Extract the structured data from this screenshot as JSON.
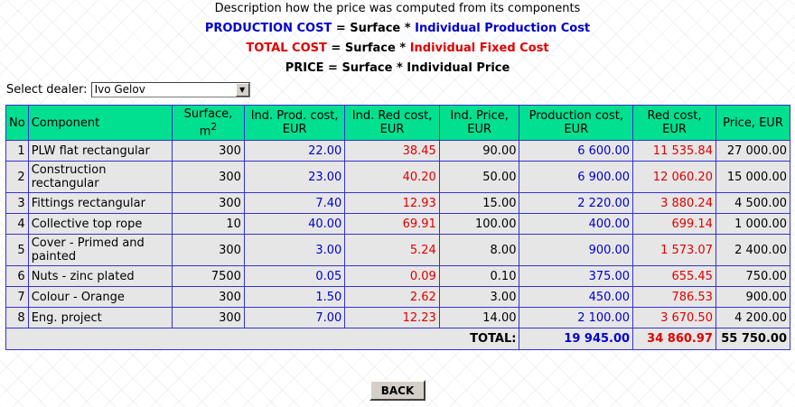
{
  "description": {
    "heading": "Description how the price was computed from its components",
    "line1": {
      "term": "PRODUCTION COST",
      "eq": " = ",
      "surface": "Surface",
      "op": " * ",
      "factor": "Individual Production Cost"
    },
    "line2": {
      "term": "TOTAL COST",
      "eq": " = ",
      "surface": "Surface",
      "op": " * ",
      "factor": "Individual Fixed Cost"
    },
    "line3": {
      "term": "PRICE",
      "eq": " = ",
      "surface": "Surface",
      "op": " * ",
      "factor": "Individual Price"
    }
  },
  "dealer": {
    "label": "Select dealer:",
    "selected": "Ivo Gelov"
  },
  "table": {
    "headers": {
      "no": "No",
      "component": "Component",
      "surface": "Surface,",
      "surface_unit": "m",
      "surface_sup": "2",
      "ind_prod_l1": "Ind. Prod. cost,",
      "ind_prod_l2": "EUR",
      "ind_red_l1": "Ind. Red cost,",
      "ind_red_l2": "EUR",
      "ind_price_l1": "Ind. Price,",
      "ind_price_l2": "EUR",
      "prod_cost_l1": "Production cost,",
      "prod_cost_l2": "EUR",
      "red_cost_l1": "Red cost,",
      "red_cost_l2": "EUR",
      "price": "Price, EUR"
    },
    "rows": [
      {
        "no": "1",
        "component": "PLW flat rectangular",
        "surface": "300",
        "ind_prod": "22.00",
        "ind_red": "38.45",
        "ind_price": "90.00",
        "prod_cost": "6 600.00",
        "red_cost": "11 535.84",
        "price": "27 000.00"
      },
      {
        "no": "2",
        "component": "Construction rectangular",
        "surface": "300",
        "ind_prod": "23.00",
        "ind_red": "40.20",
        "ind_price": "50.00",
        "prod_cost": "6 900.00",
        "red_cost": "12 060.20",
        "price": "15 000.00"
      },
      {
        "no": "3",
        "component": "Fittings rectangular",
        "surface": "300",
        "ind_prod": "7.40",
        "ind_red": "12.93",
        "ind_price": "15.00",
        "prod_cost": "2 220.00",
        "red_cost": "3 880.24",
        "price": "4 500.00"
      },
      {
        "no": "4",
        "component": "Collective top rope",
        "surface": "10",
        "ind_prod": "40.00",
        "ind_red": "69.91",
        "ind_price": "100.00",
        "prod_cost": "400.00",
        "red_cost": "699.14",
        "price": "1 000.00"
      },
      {
        "no": "5",
        "component": "Cover - Primed and painted",
        "surface": "300",
        "ind_prod": "3.00",
        "ind_red": "5.24",
        "ind_price": "8.00",
        "prod_cost": "900.00",
        "red_cost": "1 573.07",
        "price": "2 400.00"
      },
      {
        "no": "6",
        "component": "Nuts - zinc plated",
        "surface": "7500",
        "ind_prod": "0.05",
        "ind_red": "0.09",
        "ind_price": "0.10",
        "prod_cost": "375.00",
        "red_cost": "655.45",
        "price": "750.00"
      },
      {
        "no": "7",
        "component": "Colour - Orange",
        "surface": "300",
        "ind_prod": "1.50",
        "ind_red": "2.62",
        "ind_price": "3.00",
        "prod_cost": "450.00",
        "red_cost": "786.53",
        "price": "900.00"
      },
      {
        "no": "8",
        "component": "Eng. project",
        "surface": "300",
        "ind_prod": "7.00",
        "ind_red": "12.23",
        "ind_price": "14.00",
        "prod_cost": "2 100.00",
        "red_cost": "3 670.50",
        "price": "4 200.00"
      }
    ],
    "total": {
      "label": "TOTAL:",
      "prod_cost": "19 945.00",
      "red_cost": "34 860.97",
      "price": "55 750.00"
    }
  },
  "back_button": "BACK",
  "colors": {
    "header_bg": "#00e090",
    "blue": "#0000cc",
    "red": "#e00000",
    "cell_bg": "#e6e6e6",
    "border": "#3333cc"
  }
}
